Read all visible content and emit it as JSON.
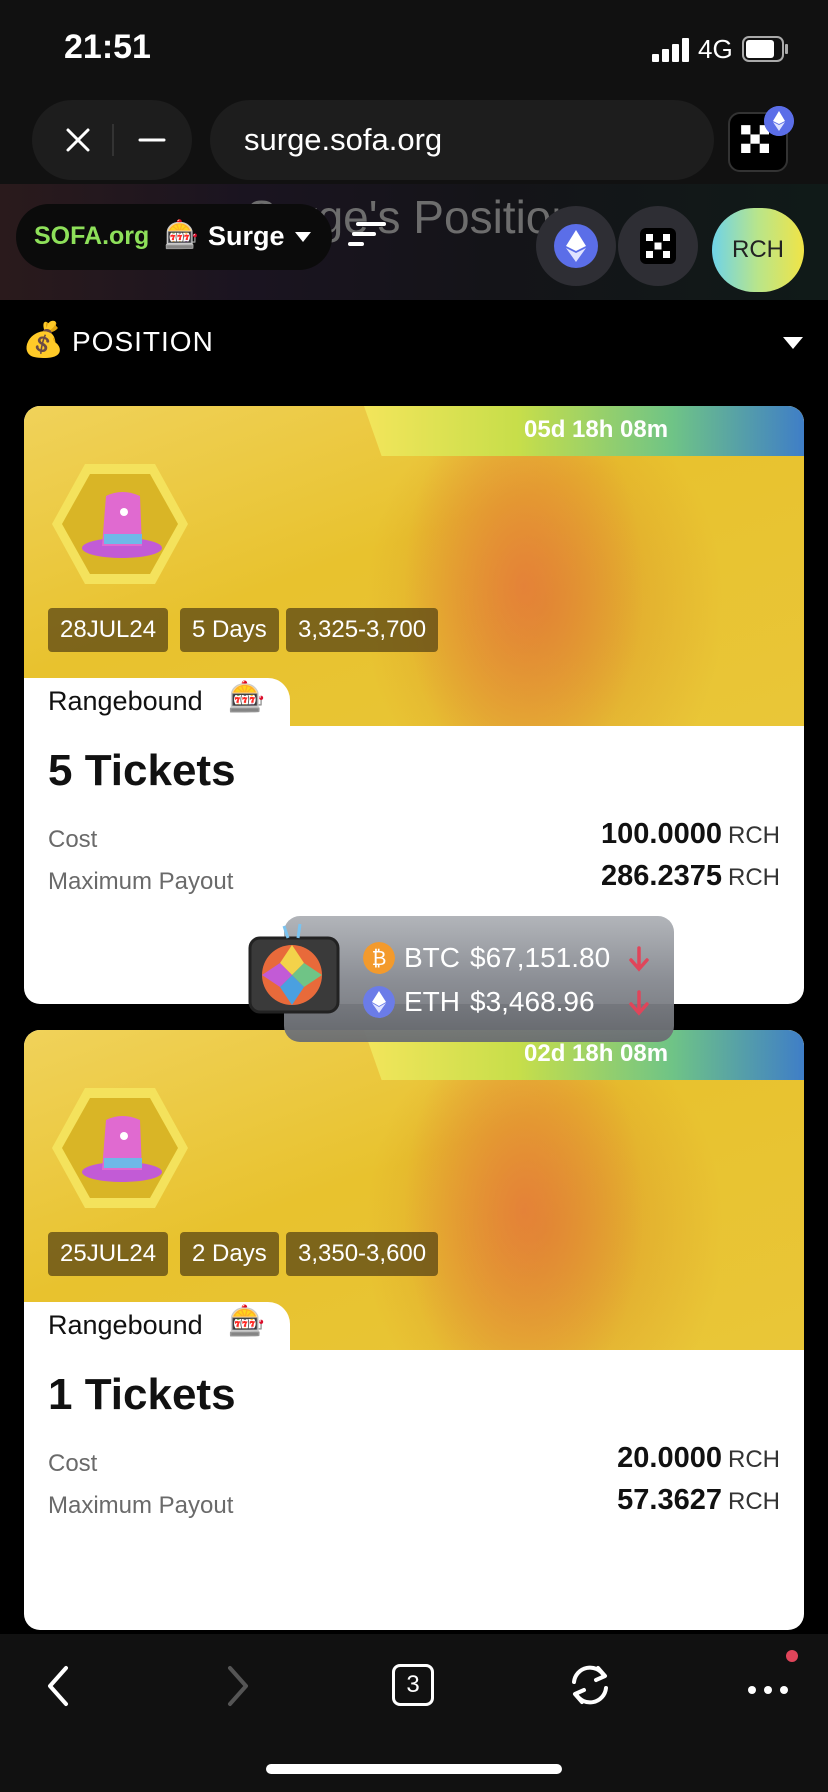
{
  "status_bar": {
    "time": "21:51",
    "network": "4G"
  },
  "browser": {
    "url": "surge.sofa.org",
    "tabs_count": "3"
  },
  "app_header": {
    "ghost_title": "Surge's Position",
    "logo": "SOFA.org",
    "product": "Surge",
    "rch_label": "RCH"
  },
  "section": {
    "label": "POSITION",
    "icon": "money-bag-icon"
  },
  "positions": [
    {
      "timer": "05d 18h 08m",
      "date": "28JUL24",
      "duration": "5 Days",
      "range": "3,325-3,700",
      "type": "Rangebound",
      "tickets": "5 Tickets",
      "cost_label": "Cost",
      "cost_value": "100.0000",
      "cost_unit": "RCH",
      "payout_label": "Maximum Payout",
      "payout_value": "286.2375",
      "payout_unit": "RCH"
    },
    {
      "timer": "02d 18h 08m",
      "date": "25JUL24",
      "duration": "2 Days",
      "range": "3,350-3,600",
      "type": "Rangebound",
      "tickets": "1 Tickets",
      "cost_label": "Cost",
      "cost_value": "20.0000",
      "cost_unit": "RCH",
      "payout_label": "Maximum Payout",
      "payout_value": "57.3627",
      "payout_unit": "RCH"
    }
  ],
  "ticker": [
    {
      "symbol": "BTC",
      "price": "$67,151.80",
      "direction": "down",
      "coin_color": "#f39a2c"
    },
    {
      "symbol": "ETH",
      "price": "$3,468.96",
      "direction": "down",
      "coin_color": "#6b7ce8"
    }
  ],
  "colors": {
    "accent_green": "#8ee05a",
    "down_red": "#e0455a",
    "card_yellow": "#e9c638"
  }
}
